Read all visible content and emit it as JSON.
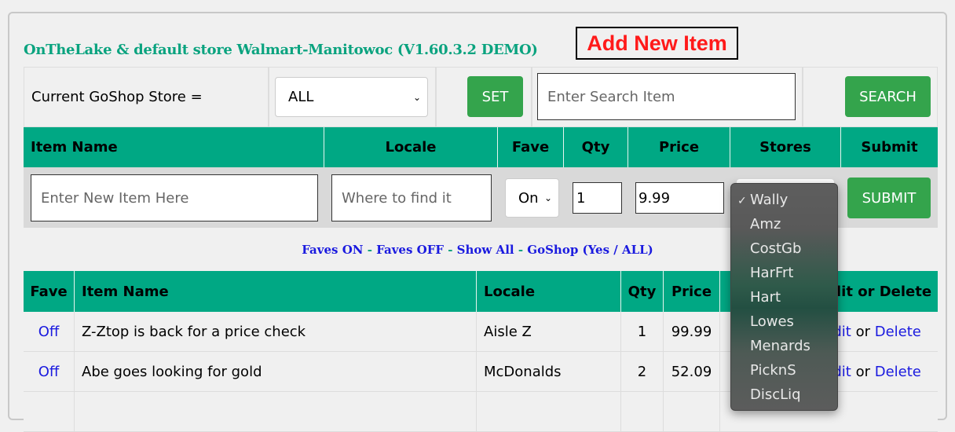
{
  "header": {
    "add_new": "Add New Item",
    "title": "OnTheLake & default store Walmart-Manitowoc (V1.60.3.2 DEMO)"
  },
  "store_bar": {
    "label": "Current GoShop Store =",
    "store_value": "ALL",
    "set_label": "SET",
    "search_placeholder": "Enter Search Item",
    "search_label": "SEARCH"
  },
  "new_item": {
    "headers": [
      "Item Name",
      "Locale",
      "Fave",
      "Qty",
      "Price",
      "Stores",
      "Submit"
    ],
    "name_placeholder": "Enter New Item Here",
    "locale_placeholder": "Where to find it",
    "fave_value": "On",
    "qty_value": "1",
    "price_value": "9.99",
    "submit_label": "SUBMIT"
  },
  "filters": {
    "faves_on": "Faves ON",
    "faves_off": "Faves OFF",
    "show_all": "Show All",
    "goshop": "GoShop (Yes / ALL)",
    "sep": " - "
  },
  "list": {
    "headers": [
      "Fave",
      "Item Name",
      "Locale",
      "Qty",
      "Price",
      "Edit or Delete"
    ],
    "rows": [
      {
        "fave": "Off",
        "name": "Z-Ztop is back for a price check",
        "locale": "Aisle Z",
        "qty": "1",
        "price": "99.99",
        "edit": "Edit",
        "or": " or ",
        "delete": "Delete"
      },
      {
        "fave": "Off",
        "name": "Abe goes looking for gold",
        "locale": "McDonalds",
        "qty": "2",
        "price": "52.09",
        "edit": "Edit",
        "or": " or ",
        "delete": "Delete"
      }
    ]
  },
  "stores_dropdown": {
    "selected": "Wally",
    "options": [
      "Wally",
      "Amz",
      "CostGb",
      "HarFrt",
      "Hart",
      "Lowes",
      "Menards",
      "PicknS",
      "DiscLiq"
    ]
  },
  "colors": {
    "accent": "#00a884",
    "button": "#34a44c",
    "title": "#0aa37f",
    "link": "#1a1adf",
    "add_new": "#ff1a1a"
  }
}
